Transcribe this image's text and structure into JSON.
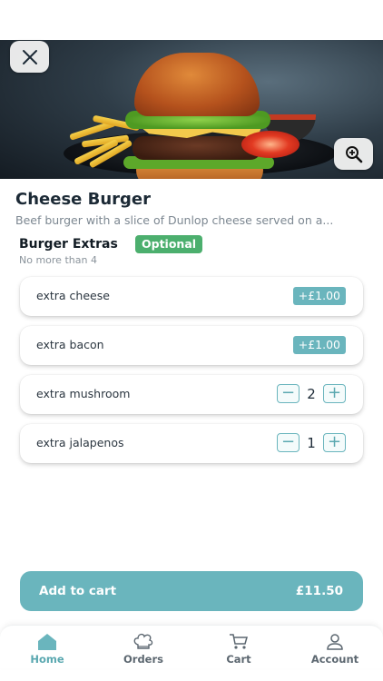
{
  "product": {
    "title": "Cheese Burger",
    "description": "Beef burger with a slice of Dunlop cheese served on a..."
  },
  "extras": {
    "title": "Burger Extras",
    "badge": "Optional",
    "limit": "No more than 4",
    "options": [
      {
        "label": "extra cheese",
        "price": "+£1.00"
      },
      {
        "label": "extra bacon",
        "price": "+£1.00"
      },
      {
        "label": "extra mushroom",
        "quantity": "2"
      },
      {
        "label": "extra jalapenos",
        "quantity": "1"
      }
    ]
  },
  "cart": {
    "label": "Add to cart",
    "total": "£11.50"
  },
  "tabs": [
    {
      "label": "Home",
      "icon": "home-icon",
      "active": true
    },
    {
      "label": "Orders",
      "icon": "chef-hat-icon"
    },
    {
      "label": "Cart",
      "icon": "cart-icon"
    },
    {
      "label": "Account",
      "icon": "user-icon"
    }
  ],
  "colors": {
    "accent": "#6ab5bd",
    "badge": "#4caf6e"
  }
}
